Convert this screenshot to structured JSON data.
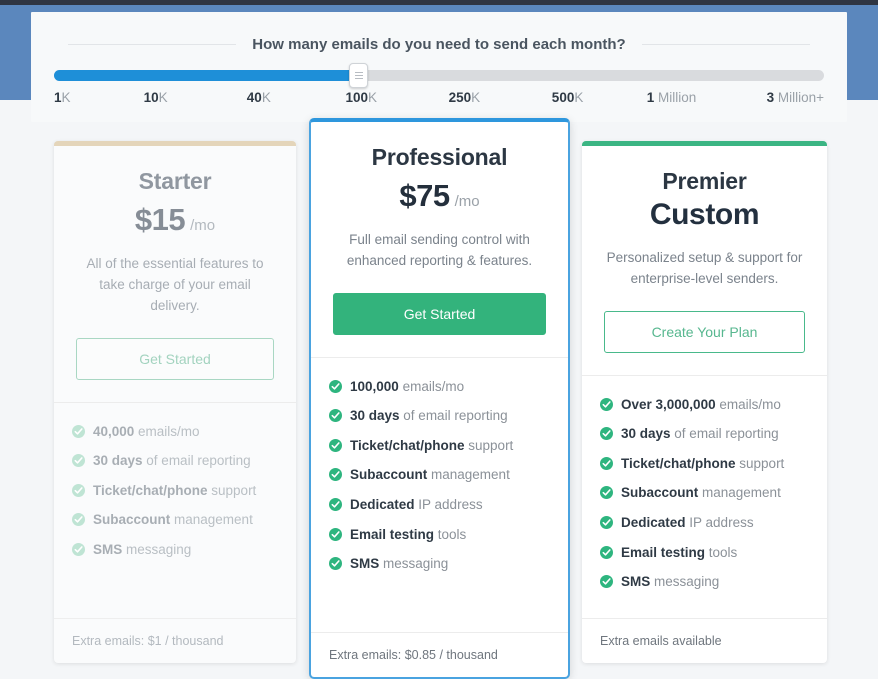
{
  "panel": {
    "heading": "How many emails do you need to send each month?"
  },
  "slider": {
    "name": "monthly-email-volume-slider",
    "selected_value": "100K",
    "fill_percent": 39.5,
    "fill_color": "#1e8fd8",
    "track_color": "#d9dbde",
    "ticks": [
      {
        "num": "1",
        "suffix": "K",
        "pos": 0
      },
      {
        "num": "10",
        "suffix": "K",
        "pos": 13.2
      },
      {
        "num": "40",
        "suffix": "K",
        "pos": 26.6
      },
      {
        "num": "100",
        "suffix": "K",
        "pos": 39.9
      },
      {
        "num": "250",
        "suffix": "K",
        "pos": 53.3
      },
      {
        "num": "500",
        "suffix": "K",
        "pos": 66.7
      },
      {
        "num": "1",
        "suffix": " Million",
        "pos": 80.2
      },
      {
        "num": "3",
        "suffix": " Million+",
        "pos": 95.0
      }
    ]
  },
  "plans": {
    "starter": {
      "name": "Starter",
      "price": "$15",
      "period": "/mo",
      "tagline": "All of the essential features to take charge of your email delivery.",
      "cta": "Get Started",
      "accent_color": "#e4d5ba",
      "state": "inactive",
      "features": [
        {
          "strong": "40,000",
          "rest": " emails/mo"
        },
        {
          "strong": "30 days",
          "rest": " of email reporting"
        },
        {
          "strong": "Ticket/chat/phone",
          "rest": " support"
        },
        {
          "strong": "Subaccount",
          "rest": " management"
        },
        {
          "strong": "SMS",
          "rest": " messaging"
        }
      ],
      "footer": "Extra emails: $1 / thousand"
    },
    "professional": {
      "name": "Professional",
      "price": "$75",
      "period": "/mo",
      "tagline": "Full email sending control with enhanced reporting & features.",
      "cta": "Get Started",
      "accent_color": "#2e97dd",
      "state": "selected",
      "features": [
        {
          "strong": "100,000",
          "rest": " emails/mo"
        },
        {
          "strong": "30 days",
          "rest": " of email reporting"
        },
        {
          "strong": "Ticket/chat/phone",
          "rest": " support"
        },
        {
          "strong": "Subaccount",
          "rest": " management"
        },
        {
          "strong": "Dedicated",
          "rest": " IP address"
        },
        {
          "strong": "Email testing",
          "rest": " tools"
        },
        {
          "strong": "SMS",
          "rest": " messaging"
        }
      ],
      "footer": "Extra emails: $0.85 / thousand"
    },
    "premier": {
      "name": "Premier",
      "price": "Custom",
      "period": "",
      "tagline": "Personalized setup & support for enterprise-level senders.",
      "cta": "Create Your Plan",
      "accent_color": "#3bb583",
      "state": "active",
      "features": [
        {
          "strong": "Over 3,000,000",
          "rest": " emails/mo"
        },
        {
          "strong": "30 days",
          "rest": " of email reporting"
        },
        {
          "strong": "Ticket/chat/phone",
          "rest": " support"
        },
        {
          "strong": "Subaccount",
          "rest": " management"
        },
        {
          "strong": "Dedicated",
          "rest": " IP address"
        },
        {
          "strong": "Email testing",
          "rest": " tools"
        },
        {
          "strong": "SMS",
          "rest": " messaging"
        }
      ],
      "footer": "Extra emails available"
    }
  },
  "icons": {
    "check": "check-circle-icon",
    "slider_handle": "slider-handle-grip-icon"
  }
}
